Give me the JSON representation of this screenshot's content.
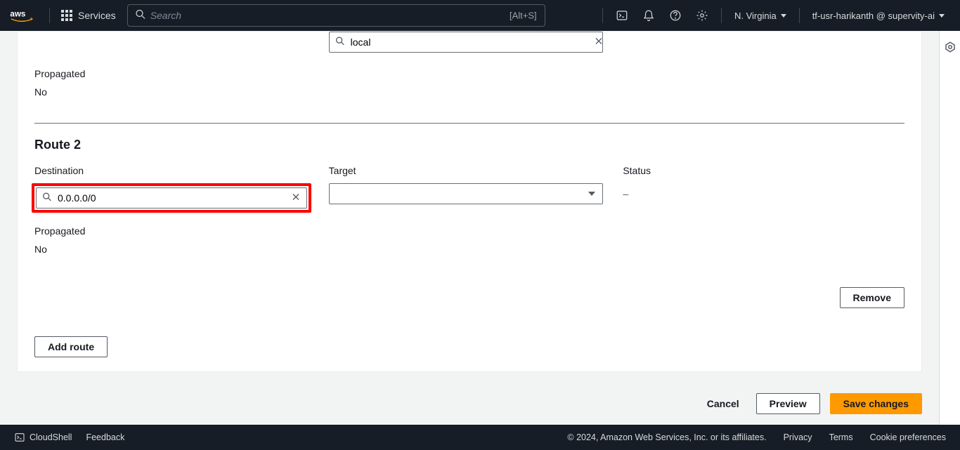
{
  "header": {
    "services_label": "Services",
    "search_placeholder": "Search",
    "search_shortcut": "[Alt+S]",
    "region": "N. Virginia",
    "user": "tf-usr-harikanth @ supervity-ai"
  },
  "route1": {
    "target_value": "local",
    "propagated_label": "Propagated",
    "propagated_value": "No"
  },
  "route2": {
    "heading": "Route 2",
    "destination_label": "Destination",
    "destination_value": "0.0.0.0/0",
    "target_label": "Target",
    "target_value": "",
    "status_label": "Status",
    "status_value": "–",
    "propagated_label": "Propagated",
    "propagated_value": "No",
    "remove_label": "Remove"
  },
  "actions": {
    "add_route": "Add route",
    "cancel": "Cancel",
    "preview": "Preview",
    "save": "Save changes"
  },
  "footer": {
    "cloudshell": "CloudShell",
    "feedback": "Feedback",
    "copyright": "© 2024, Amazon Web Services, Inc. or its affiliates.",
    "privacy": "Privacy",
    "terms": "Terms",
    "cookies": "Cookie preferences"
  }
}
